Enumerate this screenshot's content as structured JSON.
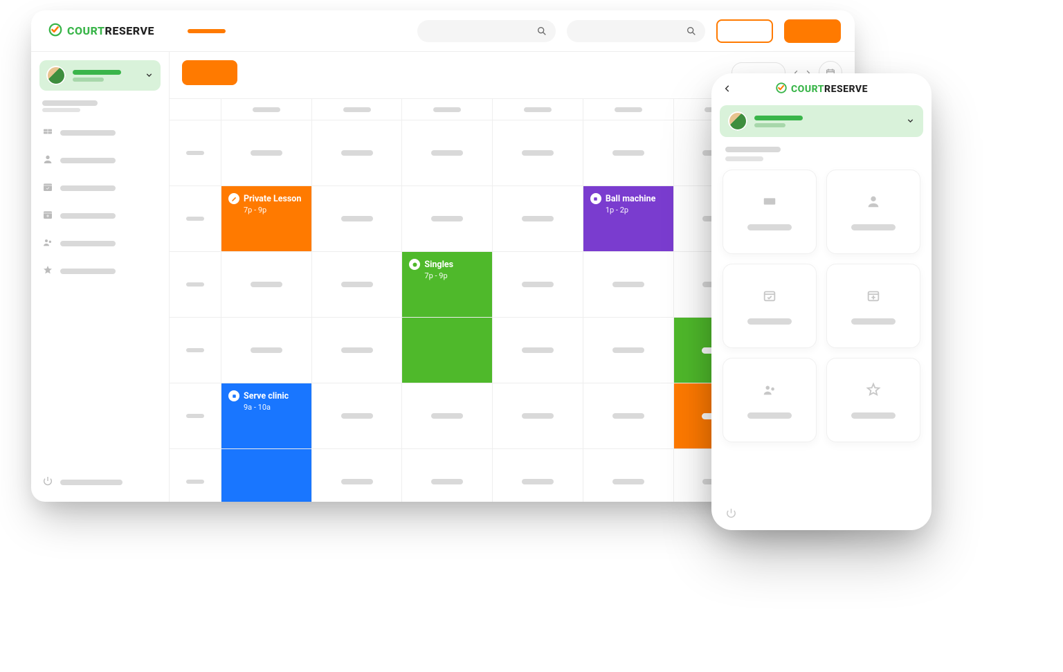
{
  "brand": {
    "name_a": "COURT",
    "name_b": "RESERVE"
  },
  "events": {
    "private_lesson": {
      "title": "Private Lesson",
      "time": "7p - 9p",
      "color": "#ff7a00"
    },
    "ball_machine": {
      "title": "Ball machine",
      "time": "1p - 2p",
      "color": "#7a3ccf"
    },
    "singles": {
      "title": "Singles",
      "time": "7p - 9p",
      "color": "#4fb92b"
    },
    "serve_clinic": {
      "title": "Serve clinic",
      "time": "9a - 10a",
      "color": "#1976ff"
    }
  },
  "grid": {
    "columns": 7,
    "rows": 6
  },
  "icons": {
    "sidebar": [
      "court-icon",
      "user-icon",
      "calendar-check-icon",
      "calendar-plus-icon",
      "group-icon",
      "star-icon"
    ],
    "mobile_tiles": [
      "court-icon",
      "user-icon",
      "calendar-check-icon",
      "calendar-plus-icon",
      "group-icon",
      "star-icon"
    ]
  }
}
